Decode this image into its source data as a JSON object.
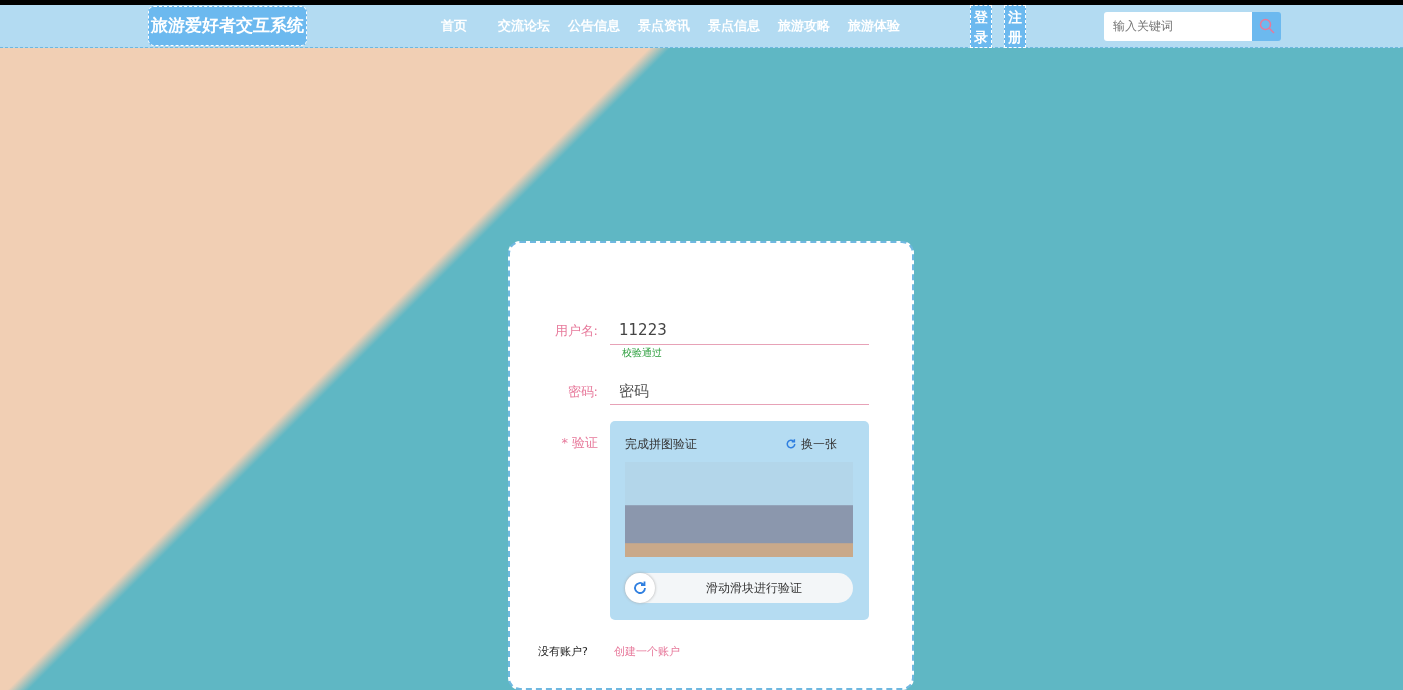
{
  "navbar": {
    "brand": "旅游爱好者交互系统",
    "links": [
      {
        "label": "首页"
      },
      {
        "label": "交流论坛"
      },
      {
        "label": "公告信息"
      },
      {
        "label": "景点资讯"
      },
      {
        "label": "景点信息"
      },
      {
        "label": "旅游攻略"
      },
      {
        "label": "旅游体验"
      }
    ],
    "auth_buttons": [
      {
        "label": "登录"
      },
      {
        "label": "注册"
      }
    ],
    "search": {
      "placeholder": "输入关键词"
    }
  },
  "login_form": {
    "username": {
      "label": "用户名:",
      "value": "11223",
      "hint": "校验通过"
    },
    "password": {
      "label": "密码:",
      "placeholder": "密码"
    },
    "captcha": {
      "label": "验证",
      "required_mark": "*",
      "title": "完成拼图验证",
      "refresh": "换一张",
      "slider_text": "滑动滑块进行验证"
    },
    "signup": {
      "prompt": "没有账户?",
      "link": "创建一个账户"
    }
  }
}
